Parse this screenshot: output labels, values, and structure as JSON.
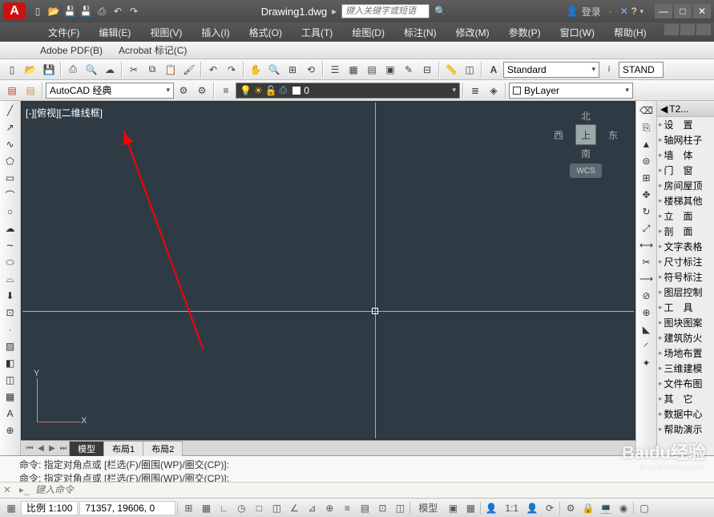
{
  "title": {
    "document": "Drawing1.dwg",
    "search_placeholder": "键入关键字或短语",
    "login": "登录"
  },
  "menus": {
    "file": "文件(F)",
    "edit": "编辑(E)",
    "view": "视图(V)",
    "insert": "插入(I)",
    "format": "格式(O)",
    "tools": "工具(T)",
    "draw": "绘图(D)",
    "dimension": "标注(N)",
    "modify": "修改(M)",
    "parametric": "参数(P)",
    "window": "窗口(W)",
    "help": "帮助(H)"
  },
  "subbar": {
    "adobe": "Adobe PDF(B)",
    "acrobat": "Acrobat 标记(C)"
  },
  "workspace": {
    "value": "AutoCAD 经典"
  },
  "layer": {
    "value": "0"
  },
  "linetype": {
    "value": "ByLayer"
  },
  "textstyle": {
    "value": "Standard"
  },
  "textstyle2": {
    "value": "STAND"
  },
  "viewport": {
    "label": "[-][俯视][二维线框]"
  },
  "viewcube": {
    "n": "北",
    "s": "南",
    "e": "东",
    "w": "西",
    "top": "上",
    "wcs": "WCS"
  },
  "ucs": {
    "x": "X",
    "y": "Y"
  },
  "layout_tabs": {
    "model": "模型",
    "layout1": "布局1",
    "layout2": "布局2"
  },
  "right_panel": {
    "title": "T2...",
    "items": [
      "设　置",
      "轴网柱子",
      "墙　体",
      "门　窗",
      "房间屋顶",
      "楼梯其他",
      "立　面",
      "剖　面",
      "文字表格",
      "尺寸标注",
      "符号标注",
      "图层控制",
      "工　具",
      "图块图案",
      "建筑防火",
      "场地布置",
      "三维建模",
      "文件布图",
      "其　它",
      "数据中心",
      "帮助演示"
    ]
  },
  "command": {
    "history1": "命令: 指定对角点或 [栏选(F)/圈围(WP)/圈交(CP)]:",
    "history2": "命令: 指定对角点或 [栏选(F)/圈围(WP)/圈交(CP)]:",
    "placeholder": "键入命令"
  },
  "status": {
    "scale": "比例 1:100",
    "coords": "71357, 19606, 0",
    "model": "模型",
    "anno": "1:1"
  },
  "watermark": {
    "main": "Baidu经验",
    "sub": "jingyan.baidu.com"
  },
  "chart_data": null
}
